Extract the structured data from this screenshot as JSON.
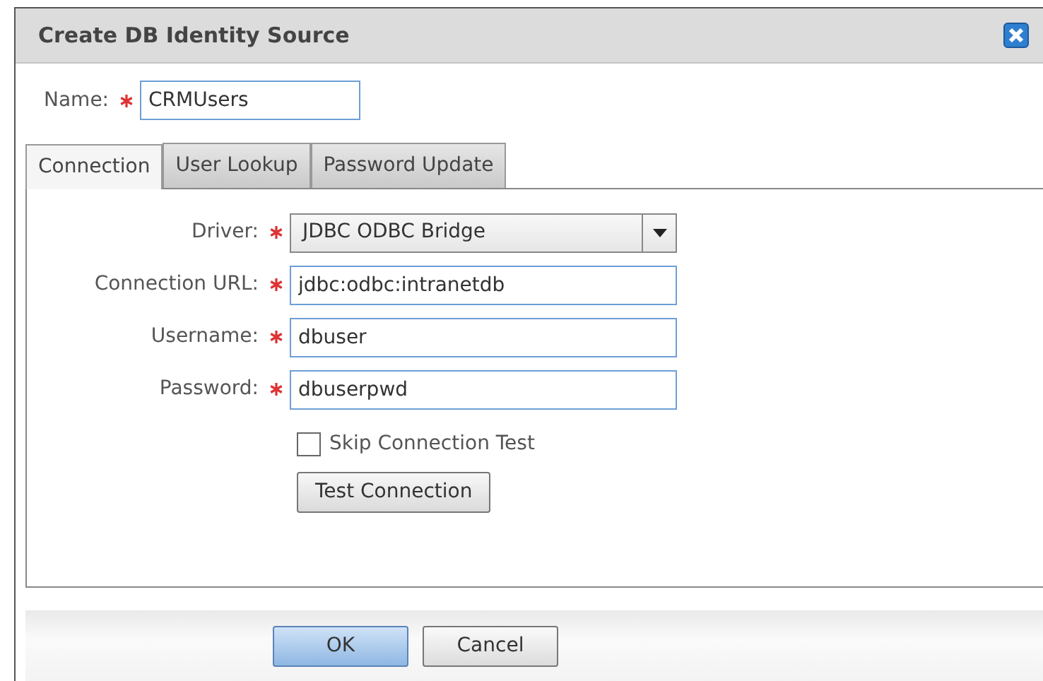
{
  "window": {
    "title": "Create DB Identity Source"
  },
  "name_field": {
    "label": "Name:",
    "required": true,
    "value": "CRMUsers"
  },
  "tabs": [
    {
      "label": "Connection",
      "selected": true
    },
    {
      "label": "User Lookup",
      "selected": false
    },
    {
      "label": "Password Update",
      "selected": false
    }
  ],
  "fields": [
    {
      "kind": "select",
      "label": "Driver:",
      "required": true,
      "value": "JDBC ODBC Bridge"
    },
    {
      "kind": "text",
      "label": "Connection URL:",
      "required": true,
      "value": "jdbc:odbc:intranetdb"
    },
    {
      "kind": "text",
      "label": "Username:",
      "required": true,
      "value": "dbuser"
    },
    {
      "kind": "text",
      "label": "Password:",
      "required": true,
      "value": "dbuserpwd"
    }
  ],
  "skip_test": {
    "label": "Skip Connection Test",
    "checked": false
  },
  "test_button": "Test Connection",
  "buttons": [
    {
      "label": "OK",
      "kind": "primary"
    },
    {
      "label": "Cancel",
      "kind": "default"
    }
  ]
}
